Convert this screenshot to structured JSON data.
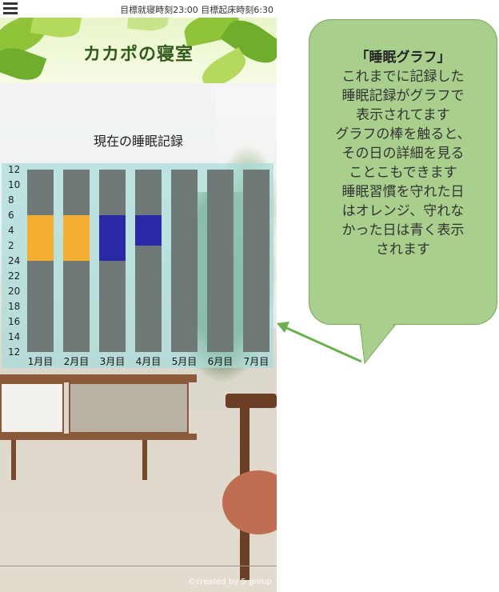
{
  "statusbar": {
    "menu_icon": "hamburger-menu-icon",
    "targets_text": "目標就寝時刻23:00 目標起床時刻6:30"
  },
  "header": {
    "title": "カカポの寝室"
  },
  "section_title": "現在の睡眠記録",
  "chart_data": {
    "type": "bar",
    "title": "",
    "y_ticks": [
      "12",
      "10",
      "8",
      "6",
      "4",
      "2",
      "24",
      "22",
      "20",
      "18",
      "16",
      "14",
      "12"
    ],
    "categories": [
      "1月目",
      "2月目",
      "3月目",
      "4月目",
      "5月目",
      "6月目",
      "7月目"
    ],
    "colors": {
      "kept": "#f5ae2f",
      "not_kept": "#2a2aa8",
      "empty": "#6f7a78",
      "panel": "#a8dcda"
    },
    "series": [
      {
        "status": "kept",
        "sleep_start": "24:00",
        "wake": "6:00"
      },
      {
        "status": "kept",
        "sleep_start": "24:00",
        "wake": "6:00"
      },
      {
        "status": "not_kept",
        "sleep_start": "24:00",
        "wake": "6:00"
      },
      {
        "status": "not_kept",
        "sleep_start": "2:00",
        "wake": "6:00"
      },
      {
        "status": "none"
      },
      {
        "status": "none"
      },
      {
        "status": "none"
      }
    ]
  },
  "footer": "©created by 5 group",
  "callout": {
    "title": "「睡眠グラフ」",
    "lines": [
      "これまでに記録した",
      "睡眠記録がグラフで",
      "表示されてます",
      "グラフの棒を触ると、",
      "その日の詳細を見る",
      "ことこもできます",
      "睡眠習慣を守れた日",
      "はオレンジ、守れな",
      "かった日は青く表示",
      "されます"
    ],
    "color": "#a9cf8d",
    "arrow_color": "#6ab04c"
  }
}
